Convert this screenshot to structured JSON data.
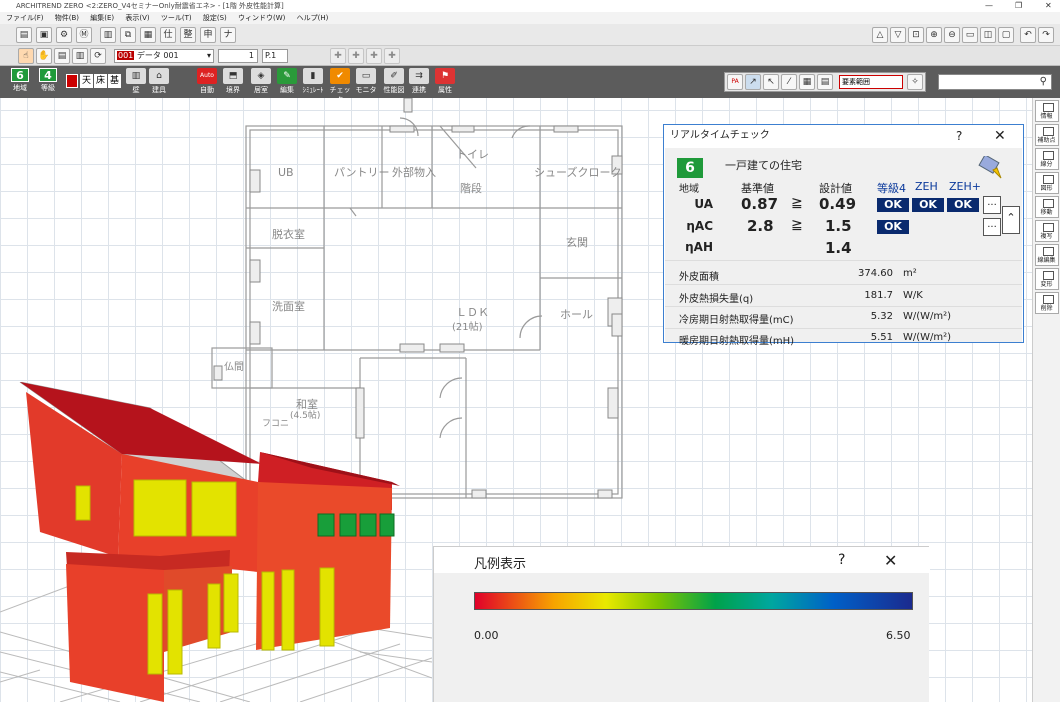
{
  "window": {
    "title": "ARCHITREND ZERO <2:ZERO_V4セミナーOnly耐震省エネ> - [1階 外皮性能計算]"
  },
  "menu": [
    "ファイル(F)",
    "物件(B)",
    "編集(E)",
    "表示(V)",
    "ツール(T)",
    "設定(S)",
    "ウィンドウ(W)",
    "ヘルプ(H)"
  ],
  "toolbar2": {
    "layer_code": "001",
    "layer_name": "データ 001",
    "line_width": "1",
    "page": "P.1"
  },
  "toolbar3": {
    "region_num": "6",
    "region_label": "地域",
    "grade_num": "4",
    "grade_label": "等級",
    "cell_labels": [
      "天",
      "床",
      "基"
    ],
    "buttons": [
      "壁",
      "建具",
      "自動",
      "境界",
      "居室",
      "編集",
      "ｼﾐｭﾚｰﾄ",
      "チェック",
      "モニタ",
      "性能図",
      "連携",
      "属性"
    ],
    "auto_icon": "Auto"
  },
  "right_tools": {
    "range_label": "要素範囲",
    "search_placeholder": ""
  },
  "sidebar": [
    "情報",
    "補助点",
    "線分",
    "図形",
    "移動",
    "複写",
    "線編集",
    "変形",
    "削除"
  ],
  "floorplan": {
    "rooms": [
      "UB",
      "パントリー",
      "外部物入",
      "トイレ",
      "シューズクローク",
      "階段",
      "脱衣室",
      "玄関",
      "洗面室",
      "ＬＤＫ",
      "(21帖)",
      "ホール",
      "仏間",
      "和室",
      "(4.5帖)",
      "フコニ"
    ]
  },
  "realtime_check": {
    "title": "リアルタイムチェック",
    "help": "?",
    "close": "✕",
    "region_value": "6",
    "region_label": "地域",
    "house_type": "一戸建ての住宅",
    "col_standard": "基準値",
    "col_design": "設計値",
    "col_grade4": "等級4",
    "col_zeh": "ZEH",
    "col_zehplus": "ZEH+",
    "geq": "≧",
    "rows": [
      {
        "name": "UA",
        "standard": "0.87",
        "design": "0.49",
        "ok": [
          "OK",
          "OK",
          "OK"
        ]
      },
      {
        "name": "ηAC",
        "standard": "2.8",
        "design": "1.5",
        "ok": [
          "OK"
        ]
      },
      {
        "name": "ηAH",
        "standard": "",
        "design": "1.4",
        "ok": []
      }
    ],
    "dots_label": "...",
    "details": [
      {
        "label": "外皮面積",
        "value": "374.60",
        "unit": "m²"
      },
      {
        "label": "外皮熱損失量(q)",
        "value": "181.7",
        "unit": "W/K"
      },
      {
        "label": "冷房期日射熱取得量(mC)",
        "value": "5.32",
        "unit": "W/(W/m²)"
      },
      {
        "label": "暖房期日射熱取得量(mH)",
        "value": "5.51",
        "unit": "W/(W/m²)"
      }
    ]
  },
  "legend": {
    "title": "凡例表示",
    "help": "?",
    "close": "✕",
    "min": "0.00",
    "max": "6.50"
  },
  "colors": {
    "ok_bg": "#0a2a6e",
    "region_green": "#1f9a3a",
    "panel_border": "#3c7fd0",
    "house_red": "#e8402a"
  }
}
